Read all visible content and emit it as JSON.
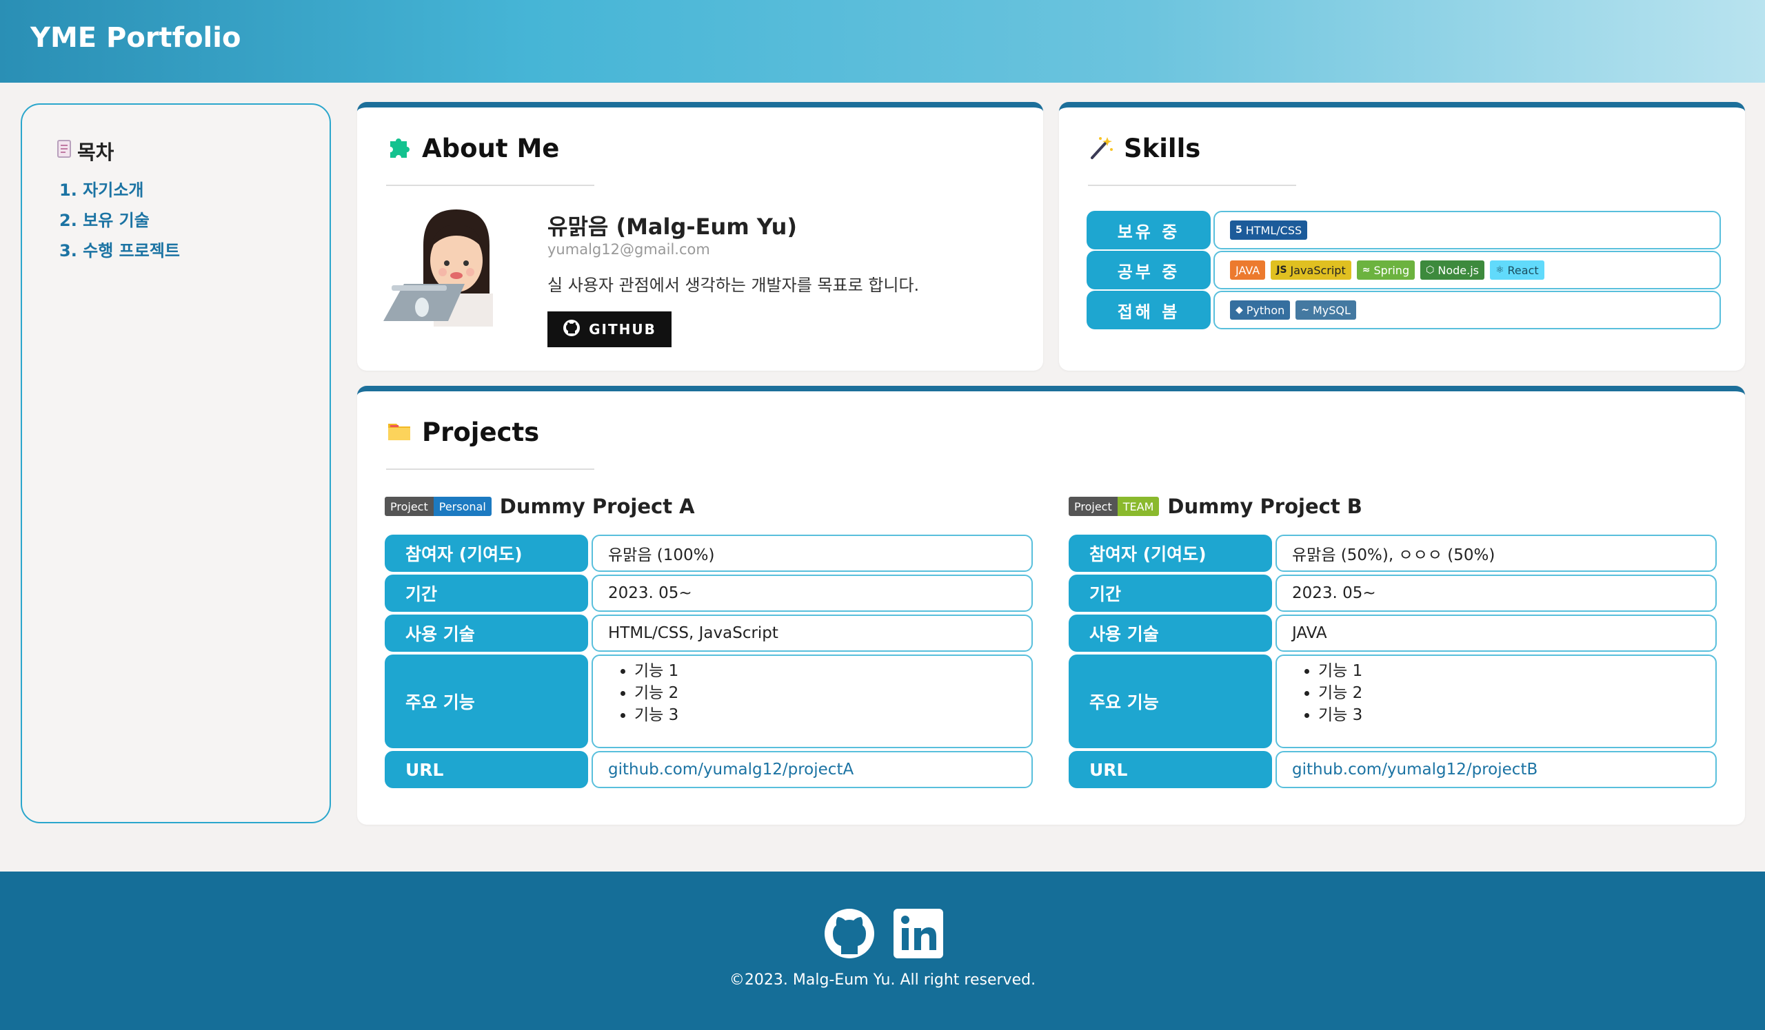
{
  "header": {
    "brand": "YME Portfolio"
  },
  "toc": {
    "title": "목차",
    "items": [
      "1. 자기소개",
      "2. 보유 기술",
      "3. 수행 프로젝트"
    ]
  },
  "about": {
    "heading": "About Me",
    "name": "유맑음 (Malg-Eum Yu)",
    "email": "yumalg12@gmail.com",
    "description": "실 사용자 관점에서 생각하는 개발자를 목표로 합니다.",
    "github_button": "GITHUB"
  },
  "skills": {
    "heading": "Skills",
    "rows": [
      {
        "label": "보유 중",
        "badges": [
          {
            "text": "HTML/CSS",
            "color": "#1c5b9a"
          }
        ]
      },
      {
        "label": "공부 중",
        "badges": [
          {
            "text": "JAVA",
            "color": "#ec7a2e"
          },
          {
            "text": "JavaScript",
            "color": "#e0c021"
          },
          {
            "text": "Spring",
            "color": "#6cb33f"
          },
          {
            "text": "Node.js",
            "color": "#3d8a3d"
          },
          {
            "text": "React",
            "color": "#61dafb"
          }
        ]
      },
      {
        "label": "접해 봄",
        "badges": [
          {
            "text": "Python",
            "color": "#356f9f"
          },
          {
            "text": "MySQL",
            "color": "#4479a1"
          }
        ]
      }
    ]
  },
  "projects": {
    "heading": "Projects",
    "items": [
      {
        "tag_left": "Project",
        "tag_right": "Personal",
        "tag_color": "#1c7ac1",
        "name": "Dummy Project A",
        "participants_label": "참여자 (기여도)",
        "participants": "유맑음 (100%)",
        "period_label": "기간",
        "period": "2023. 05~",
        "tech_label": "사용 기술",
        "tech": "HTML/CSS, JavaScript",
        "features_label": "주요 기능",
        "features": [
          "기능 1",
          "기능 2",
          "기능 3"
        ],
        "url_label": "URL",
        "url": "github.com/yumalg12/projectA"
      },
      {
        "tag_left": "Project",
        "tag_right": "TEAM",
        "tag_color": "#8ab92d",
        "name": "Dummy Project B",
        "participants_label": "참여자 (기여도)",
        "participants": "유맑음 (50%), ㅇㅇㅇ (50%)",
        "period_label": "기간",
        "period": "2023. 05~",
        "tech_label": "사용 기술",
        "tech": "JAVA",
        "features_label": "주요 기능",
        "features": [
          "기능 1",
          "기능 2",
          "기능 3"
        ],
        "url_label": "URL",
        "url": "github.com/yumalg12/projectB"
      }
    ]
  },
  "footer": {
    "copyright": "©2023. Malg-Eum Yu. All right reserved."
  }
}
